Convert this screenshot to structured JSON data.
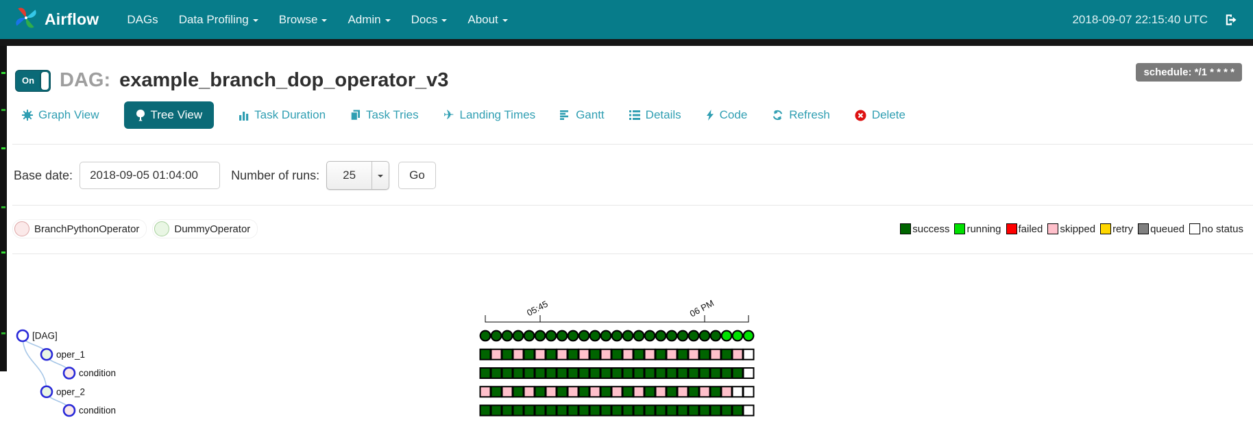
{
  "colors": {
    "navbar": "#077c8a",
    "tab_active": "#0b6a77",
    "tab_link": "#2f9eb2",
    "badge_bg": "#7a7a7a",
    "node_stroke": "#2929d8",
    "link_line": "#a7c7e7"
  },
  "navbar": {
    "brand": "Airflow",
    "items": [
      {
        "label": "DAGs",
        "dropdown": false
      },
      {
        "label": "Data Profiling",
        "dropdown": true
      },
      {
        "label": "Browse",
        "dropdown": true
      },
      {
        "label": "Admin",
        "dropdown": true
      },
      {
        "label": "Docs",
        "dropdown": true
      },
      {
        "label": "About",
        "dropdown": true
      }
    ],
    "clock": "2018-09-07 22:15:40 UTC",
    "logout_icon": "logout-icon"
  },
  "header": {
    "toggle_label": "On",
    "toggle_state": "on",
    "dag_prefix": "DAG:",
    "dag_title": "example_branch_dop_operator_v3",
    "schedule_badge": "schedule: */1 * * * *"
  },
  "tabs": [
    {
      "label": "Graph View",
      "icon": "sun-icon",
      "active": false
    },
    {
      "label": "Tree View",
      "icon": "tree-icon",
      "active": true
    },
    {
      "label": "Task Duration",
      "icon": "bar-chart-icon",
      "active": false
    },
    {
      "label": "Task Tries",
      "icon": "copy-icon",
      "active": false
    },
    {
      "label": "Landing Times",
      "icon": "plane-icon",
      "active": false
    },
    {
      "label": "Gantt",
      "icon": "align-left-icon",
      "active": false
    },
    {
      "label": "Details",
      "icon": "list-icon",
      "active": false
    },
    {
      "label": "Code",
      "icon": "bolt-icon",
      "active": false
    },
    {
      "label": "Refresh",
      "icon": "refresh-icon",
      "active": false
    },
    {
      "label": "Delete",
      "icon": "delete-icon",
      "active": false
    }
  ],
  "controls": {
    "base_date_label": "Base date:",
    "base_date_value": "2018-09-05 01:04:00",
    "num_runs_label": "Number of runs:",
    "num_runs_value": "25",
    "go_label": "Go"
  },
  "operator_legend": [
    {
      "label": "BranchPythonOperator",
      "fill": "#fbe9e9",
      "stroke": "#dca4a4"
    },
    {
      "label": "DummyOperator",
      "fill": "#e9f6e4",
      "stroke": "#a6cf9b"
    }
  ],
  "status_legend": [
    {
      "label": "success",
      "color": "#006400"
    },
    {
      "label": "running",
      "color": "#00e000"
    },
    {
      "label": "failed",
      "color": "#ff0000"
    },
    {
      "label": "skipped",
      "color": "#ffc0cb"
    },
    {
      "label": "retry",
      "color": "#ffd700"
    },
    {
      "label": "queued",
      "color": "#808080"
    },
    {
      "label": "no status",
      "color": "#ffffff"
    }
  ],
  "chart_data": {
    "type": "heatmap",
    "columns": 25,
    "x_axis": {
      "tick_labels": [
        {
          "col": 5,
          "label": "05:45"
        },
        {
          "col": 20,
          "label": "06 PM"
        }
      ],
      "end_tick_cols": [
        0,
        24
      ]
    },
    "state_colors": {
      "S": "#006400",
      "R": "#00e000",
      "K": "#ffc0cb",
      "N": "#ffffff"
    },
    "state_names": {
      "S": "success",
      "R": "running",
      "K": "skipped",
      "N": "no status"
    },
    "rows": [
      {
        "name": "[DAG]",
        "depth": 0,
        "shape": "circle",
        "node_fill": "#ffffff",
        "states": "SSSSSSSSSSSSSSSSSSSSSSRRR"
      },
      {
        "name": "oper_1",
        "depth": 1,
        "shape": "rect",
        "node_fill": "#e9f6e4",
        "states": "SKSKSKSKSKSKSKSKSKSKSKSKN"
      },
      {
        "name": "condition",
        "depth": 2,
        "shape": "rect",
        "node_fill": "#fbe9e9",
        "states": "SSSSSSSSSSSSSSSSSSSSSSSSN"
      },
      {
        "name": "oper_2",
        "depth": 1,
        "shape": "rect",
        "node_fill": "#e9f6e4",
        "states": "KSKSKSKSKSKSKSKSKSKSKSKNN"
      },
      {
        "name": "condition",
        "depth": 2,
        "shape": "rect",
        "node_fill": "#fbe9e9",
        "states": "SSSSSSSSSSSSSSSSSSSSSSSSN"
      }
    ],
    "links": [
      [
        0,
        1
      ],
      [
        1,
        2
      ],
      [
        0,
        3
      ],
      [
        3,
        4
      ]
    ]
  }
}
